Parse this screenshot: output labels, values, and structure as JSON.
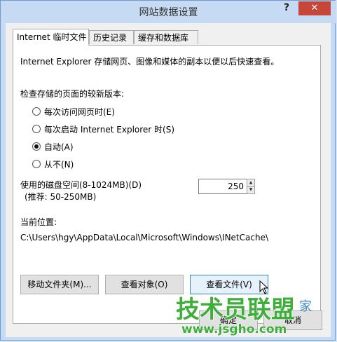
{
  "window": {
    "title": "网站数据设置",
    "help_label": "?",
    "close_label": "✕"
  },
  "tabs": [
    {
      "label": "Internet 临时文件",
      "active": true
    },
    {
      "label": "历史记录",
      "active": false
    },
    {
      "label": "缓存和数据库",
      "active": false
    }
  ],
  "temp_files": {
    "description": "Internet Explorer 存储网页、图像和媒体的副本以便以后快速查看。",
    "check_label": "检查存储的页面的较新版本:",
    "options": [
      {
        "label": "每次访问网页时(E)",
        "checked": false
      },
      {
        "label": "每次启动 Internet Explorer 时(S)",
        "checked": false
      },
      {
        "label": "自动(A)",
        "checked": true
      },
      {
        "label": "从不(N)",
        "checked": false
      }
    ],
    "disk_space_label": "使用的磁盘空间(8-1024MB)(D)",
    "disk_space_hint": "(推荐: 50-250MB)",
    "disk_space_value": "250",
    "current_location_label": "当前位置:",
    "current_location_path": "C:\\Users\\hgy\\AppData\\Local\\Microsoft\\Windows\\INetCache\\",
    "buttons": {
      "move_folder": "移动文件夹(M)...",
      "view_objects": "查看对象(O)",
      "view_files": "查看文件(V)"
    }
  },
  "footer": {
    "ok_label": "确定",
    "cancel_label": "取消"
  },
  "watermark": {
    "brand": "技术员联盟",
    "url": "www.jsgho.com",
    "tail": "家"
  }
}
